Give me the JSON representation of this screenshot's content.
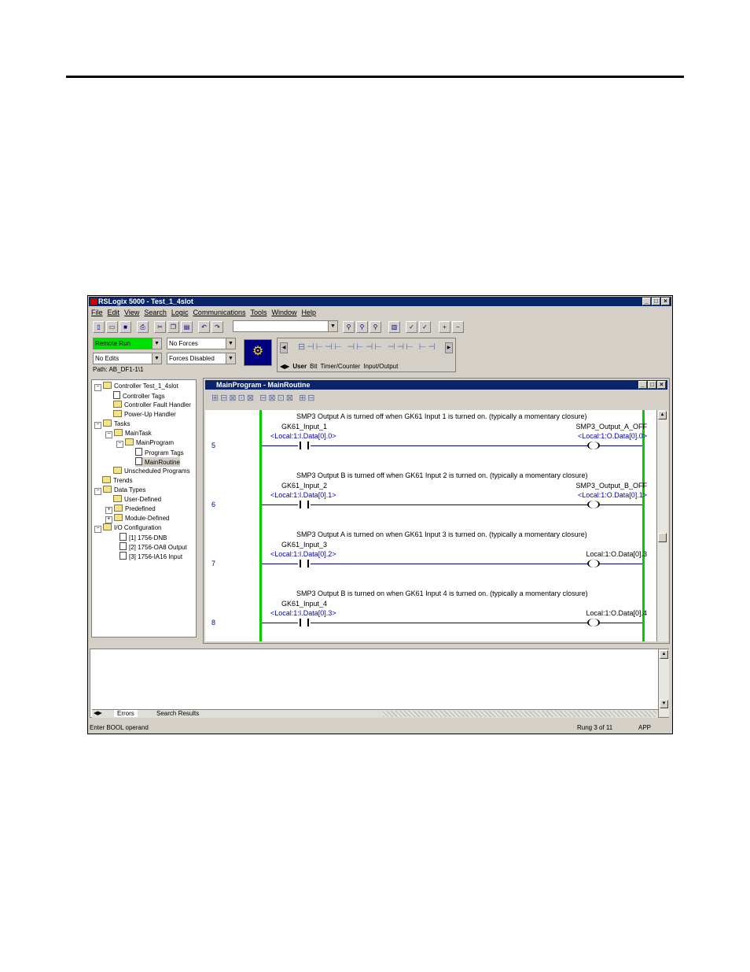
{
  "window": {
    "title": "RSLogix 5000 - Test_1_4slot"
  },
  "menu": [
    "File",
    "Edit",
    "View",
    "Search",
    "Logic",
    "Communications",
    "Tools",
    "Window",
    "Help"
  ],
  "status_combos": {
    "mode": "Remote Run",
    "forces": "No Forces",
    "edits": "No Edits",
    "forces_state": "Forces Disabled",
    "path": "Path: AB_DF1-1\\1"
  },
  "instr_tabs": [
    "User",
    "Bit",
    "Timer/Counter",
    "Input/Output"
  ],
  "tree": {
    "controller": "Controller Test_1_4slot",
    "controller_tags": "Controller Tags",
    "fault_handler": "Controller Fault Handler",
    "powerup": "Power-Up Handler",
    "tasks": "Tasks",
    "main_task": "MainTask",
    "main_program": "MainProgram",
    "program_tags": "Program Tags",
    "main_routine": "MainRoutine",
    "unscheduled": "Unscheduled Programs",
    "trends": "Trends",
    "data_types": "Data Types",
    "user_defined": "User-Defined",
    "predefined": "Predefined",
    "module_defined": "Module-Defined",
    "io_config": "I/O Configuration",
    "mod1": "[1] 1756-DNB",
    "mod2": "[2] 1756-OA8 Output",
    "mod3": "[3] 1756-IA16 Input"
  },
  "routine": {
    "title": "MainProgram - MainRoutine"
  },
  "rungs": [
    {
      "num": "5",
      "comment": "SMP3 Output A is turned off when GK61 Input 1 is turned on. (typically a momentary closure)",
      "in_tag": "GK61_Input_1",
      "in_addr": "<Local:1:I.Data[0].0>",
      "out_tag": "SMP3_Output_A_OFF",
      "out_addr": "<Local:1:O.Data[0].0>"
    },
    {
      "num": "6",
      "comment": "SMP3 Output B is turned off when GK61 Input 2 is turned on. (typically a momentary closure)",
      "in_tag": "GK61_Input_2",
      "in_addr": "<Local:1:I.Data[0].1>",
      "out_tag": "SMP3_Output_B_OFF",
      "out_addr": "<Local:1:O.Data[0].1>"
    },
    {
      "num": "7",
      "comment": "SMP3 Output A is turned on when GK61 Input 3 is turned on. (typically a momentary closure)",
      "in_tag": "GK61_Input_3",
      "in_addr": "<Local:1:I.Data[0].2>",
      "out_tag": "",
      "out_addr": "Local:1:O.Data[0].3"
    },
    {
      "num": "8",
      "comment": "SMP3 Output B is turned on when GK61 Input 4 is turned on. (typically a momentary closure)",
      "in_tag": "GK61_Input_4",
      "in_addr": "<Local:1:I.Data[0].3>",
      "out_tag": "",
      "out_addr": "Local:1:O.Data[0].4"
    }
  ],
  "bottom_tabs": [
    "Errors",
    "Search Results"
  ],
  "statusbar": {
    "message": "Enter BOOL operand",
    "rung": "Rung 3 of 11",
    "mode": "APP"
  }
}
